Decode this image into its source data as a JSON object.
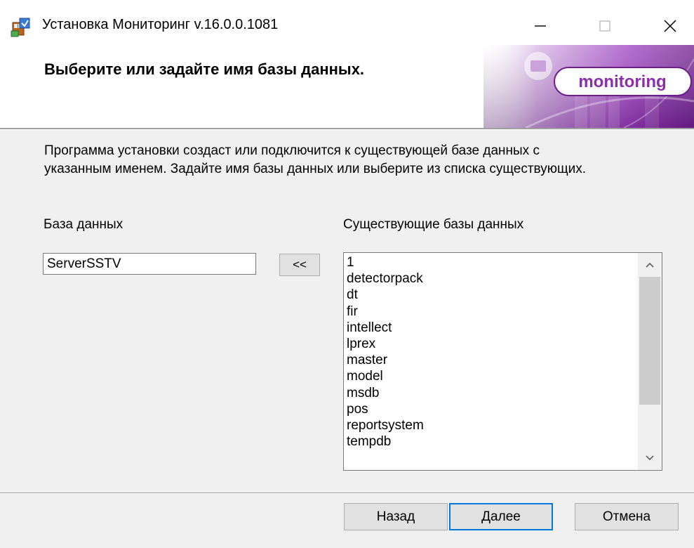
{
  "window": {
    "title": "Установка Мониторинг v.16.0.0.1081",
    "icons": {
      "app": "installer-package-icon",
      "minimize": "minimize-icon",
      "maximize": "maximize-icon",
      "close": "close-icon"
    }
  },
  "banner": {
    "title": "Выберите или задайте имя базы данных.",
    "logo_text": "monitoring",
    "accent_color": "#8a2fa8"
  },
  "description": {
    "line1": "Программа установки создаст или подключится к существующей базе данных с",
    "line2": "указанным именем. Задайте имя базы данных или выберите из списка существующих."
  },
  "database": {
    "label": "База данных",
    "value": "ServerSSTV",
    "transfer_button": "<<"
  },
  "existing": {
    "label": "Существующие базы данных",
    "items": [
      "1",
      "detectorpack",
      "dt",
      "fir",
      "intellect",
      "lprex",
      "master",
      "model",
      "msdb",
      "pos",
      "reportsystem",
      "tempdb"
    ]
  },
  "buttons": {
    "back": "Назад",
    "next": "Далее",
    "cancel": "Отмена"
  }
}
